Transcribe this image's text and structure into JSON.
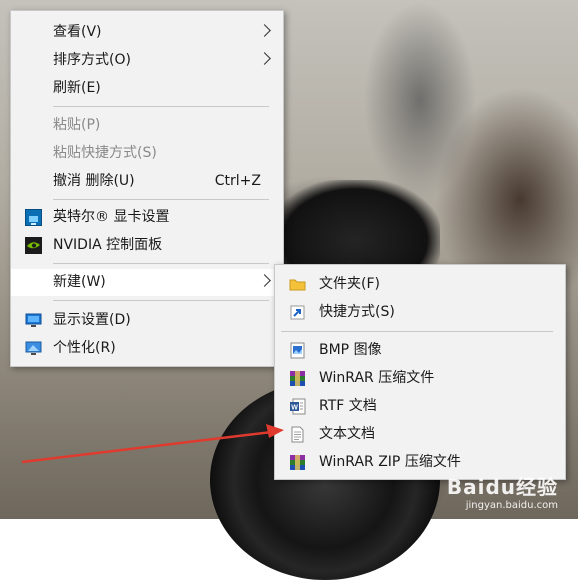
{
  "context_menu": {
    "items": [
      {
        "label": "查看(V)",
        "submenu": true
      },
      {
        "label": "排序方式(O)",
        "submenu": true
      },
      {
        "label": "刷新(E)"
      },
      {
        "label": "粘贴(P)",
        "disabled": true
      },
      {
        "label": "粘贴快捷方式(S)",
        "disabled": true
      },
      {
        "label": "撤消 删除(U)",
        "shortcut": "Ctrl+Z"
      },
      {
        "label": "英特尔® 显卡设置",
        "icon": "intel-graphics-icon"
      },
      {
        "label": "NVIDIA 控制面板",
        "icon": "nvidia-icon"
      },
      {
        "label": "新建(W)",
        "submenu": true,
        "highlighted": true
      },
      {
        "label": "显示设置(D)",
        "icon": "display-settings-icon"
      },
      {
        "label": "个性化(R)",
        "icon": "personalize-icon"
      }
    ]
  },
  "new_submenu": {
    "items": [
      {
        "label": "文件夹(F)",
        "icon": "folder-icon"
      },
      {
        "label": "快捷方式(S)",
        "icon": "shortcut-icon"
      },
      {
        "label": "BMP 图像",
        "icon": "bmp-image-icon"
      },
      {
        "label": "WinRAR 压缩文件",
        "icon": "winrar-icon"
      },
      {
        "label": "RTF 文档",
        "icon": "rtf-document-icon"
      },
      {
        "label": "文本文档",
        "icon": "text-document-icon"
      },
      {
        "label": "WinRAR ZIP 压缩文件",
        "icon": "winrar-zip-icon"
      }
    ]
  },
  "watermark": {
    "logo": "Baidu经验",
    "url": "jingyan.baidu.com"
  },
  "colors": {
    "menu_bg": "#f2f2f2",
    "hover_bg": "#ffffff",
    "annotation_arrow": "#e03a2e"
  }
}
